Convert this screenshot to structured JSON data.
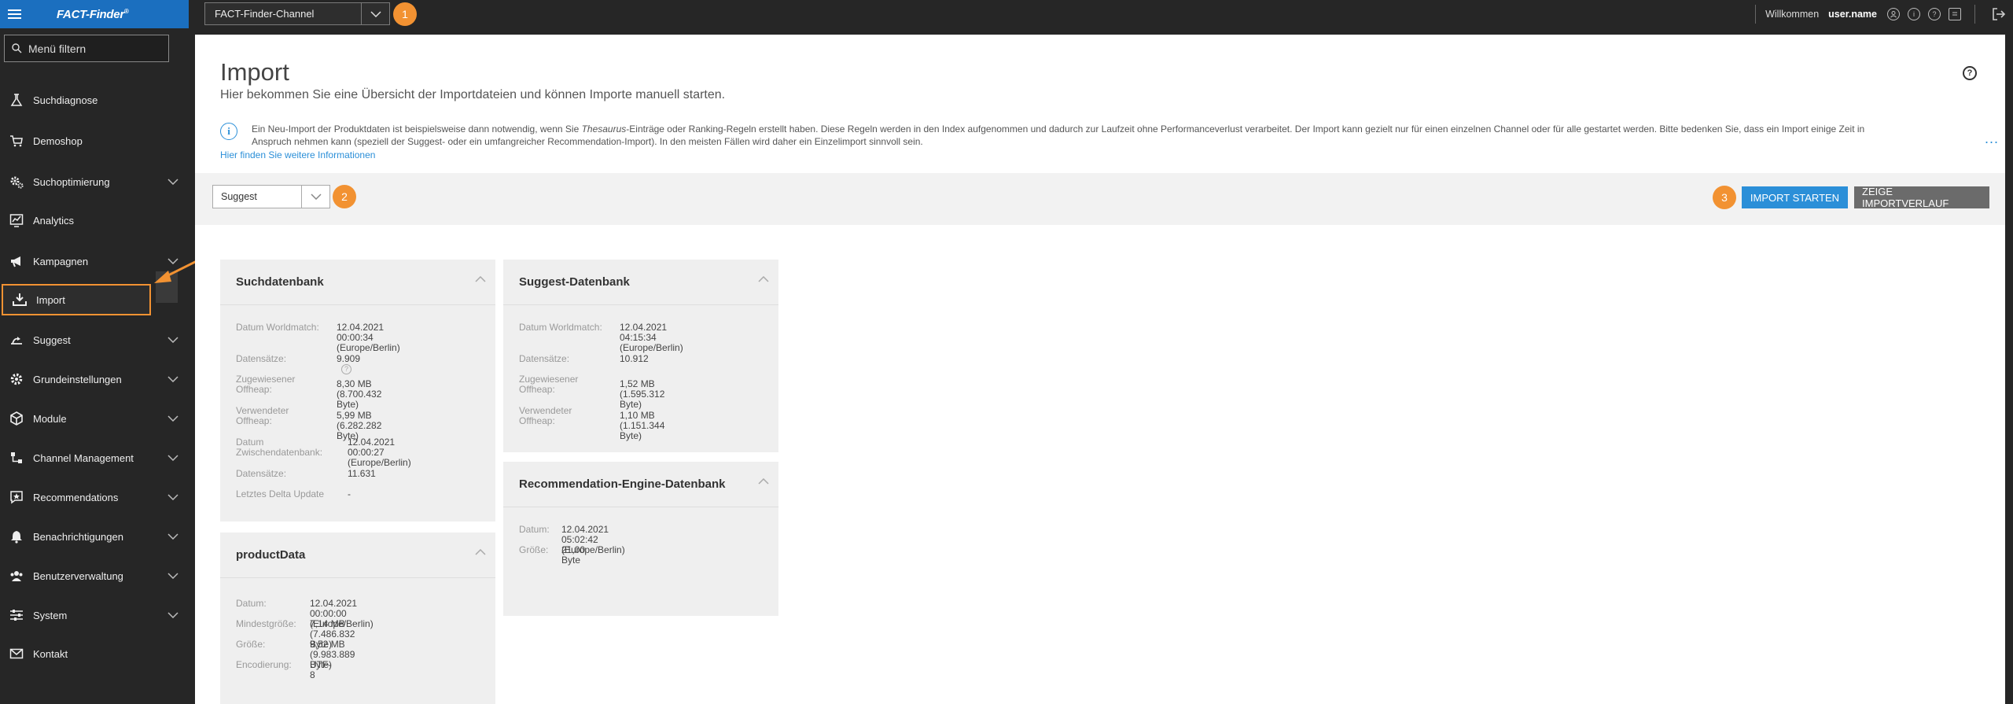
{
  "app": {
    "logo": "FACT-Finder",
    "logo_reg": "®",
    "channel": "FACT-Finder-Channel",
    "welcome": "Willkommen",
    "username": "user.name"
  },
  "annotations": {
    "badge1": "1",
    "badge2": "2",
    "badge3": "3",
    "accent": "#f29232"
  },
  "sidebar": {
    "filter_placeholder": "Menü filtern",
    "items": [
      {
        "label": "Suchdiagnose",
        "icon": "flask-icon",
        "has_submenu": false
      },
      {
        "label": "Demoshop",
        "icon": "cart-icon",
        "has_submenu": false
      },
      {
        "label": "Suchoptimierung",
        "icon": "gears-icon",
        "has_submenu": true
      },
      {
        "label": "Analytics",
        "icon": "chart-icon",
        "has_submenu": false
      },
      {
        "label": "Kampagnen",
        "icon": "megaphone-icon",
        "has_submenu": true
      },
      {
        "label": "Import",
        "icon": "download-icon",
        "has_submenu": false
      },
      {
        "label": "Suggest",
        "icon": "suggest-icon",
        "has_submenu": true
      },
      {
        "label": "Grundeinstellungen",
        "icon": "gear-icon",
        "has_submenu": true
      },
      {
        "label": "Module",
        "icon": "cube-icon",
        "has_submenu": true
      },
      {
        "label": "Channel Management",
        "icon": "channels-icon",
        "has_submenu": true
      },
      {
        "label": "Recommendations",
        "icon": "recommendation-icon",
        "has_submenu": true
      },
      {
        "label": "Benachrichtigungen",
        "icon": "bell-icon",
        "has_submenu": true
      },
      {
        "label": "Benutzerverwaltung",
        "icon": "users-icon",
        "has_submenu": true
      },
      {
        "label": "System",
        "icon": "sliders-icon",
        "has_submenu": true
      },
      {
        "label": "Kontakt",
        "icon": "mail-icon",
        "has_submenu": false
      }
    ],
    "active_index": 5
  },
  "page": {
    "title": "Import",
    "subtitle": "Hier bekommen Sie eine Übersicht der Importdateien und können Importe manuell starten.",
    "info_line1_a": "Ein Neu-Import der Produktdaten ist beispielsweise dann notwendig, wenn Sie ",
    "info_line1_em": "Thesaurus",
    "info_line1_b": "-Einträge oder Ranking-Regeln erstellt haben. Diese Regeln werden in den Index aufgenommen und dadurch zur Laufzeit ohne Performanceverlust verarbeitet. Der Import kann gezielt nur für einen einzelnen Channel oder für alle gestartet werden. Bitte bedenken Sie, dass ein Import einige Zeit in",
    "info_line2": "Anspruch nehmen kann (speziell der Suggest- oder ein umfangreicher Recommendation-Import). In den meisten Fällen wird daher ein Einzelimport sinnvoll sein.",
    "info_link": "Hier finden Sie weitere Informationen",
    "info_more": "..."
  },
  "toolbar": {
    "type_selected": "Suggest",
    "start_import": "IMPORT STARTEN",
    "show_history": "ZEIGE IMPORTVERLAUF"
  },
  "cards": {
    "suchdatenbank": {
      "title": "Suchdatenbank",
      "rows": [
        {
          "k": "Datum Worldmatch:",
          "v1": "12.04.2021 00:00:34",
          "v2": "(Europe/Berlin)"
        },
        {
          "k": "Datensätze:",
          "v1": "9.909"
        },
        {
          "k1": "Zugewiesener",
          "k2": "Offheap:",
          "v1": "8,30 MB (8.700.432 Byte)"
        },
        {
          "k1": "Verwendeter",
          "k2": "Offheap:",
          "v1": "5,99 MB (6.282.282 Byte)"
        },
        {
          "k1": "Datum",
          "k2": "Zwischendatenbank:",
          "v1": "12.04.2021 00:00:27",
          "v2": "(Europe/Berlin)"
        },
        {
          "k": "Datensätze:",
          "v1": "11.631"
        },
        {
          "k": "Letztes Delta Update",
          "v1": "-"
        }
      ]
    },
    "suggest": {
      "title": "Suggest-Datenbank",
      "rows": [
        {
          "k": "Datum Worldmatch:",
          "v1": "12.04.2021 04:15:34",
          "v2": "(Europe/Berlin)"
        },
        {
          "k": "Datensätze:",
          "v1": "10.912"
        },
        {
          "k1": "Zugewiesener",
          "k2": "Offheap:",
          "v1": "1,52 MB (1.595.312 Byte)"
        },
        {
          "k1": "Verwendeter",
          "k2": "Offheap:",
          "v1": "1,10 MB (1.151.344 Byte)"
        }
      ]
    },
    "recommendation": {
      "title": "Recommendation-Engine-Datenbank",
      "rows": [
        {
          "k": "Datum:",
          "v1": "12.04.2021 05:02:42 (Europe/Berlin)"
        },
        {
          "k": "Größe:",
          "v1": "21,00 Byte"
        }
      ]
    },
    "productdata": {
      "title": "productData",
      "rows": [
        {
          "k": "Datum:",
          "v1": "12.04.2021 00:00:00 (Europe/Berlin)"
        },
        {
          "k": "Mindestgröße:",
          "v1": "7,14 MB (7.486.832 Byte)"
        },
        {
          "k": "Größe:",
          "v1": "9,52 MB (9.983.889 Byte)"
        },
        {
          "k": "Encodierung:",
          "v1": "UTF-8"
        }
      ]
    }
  }
}
